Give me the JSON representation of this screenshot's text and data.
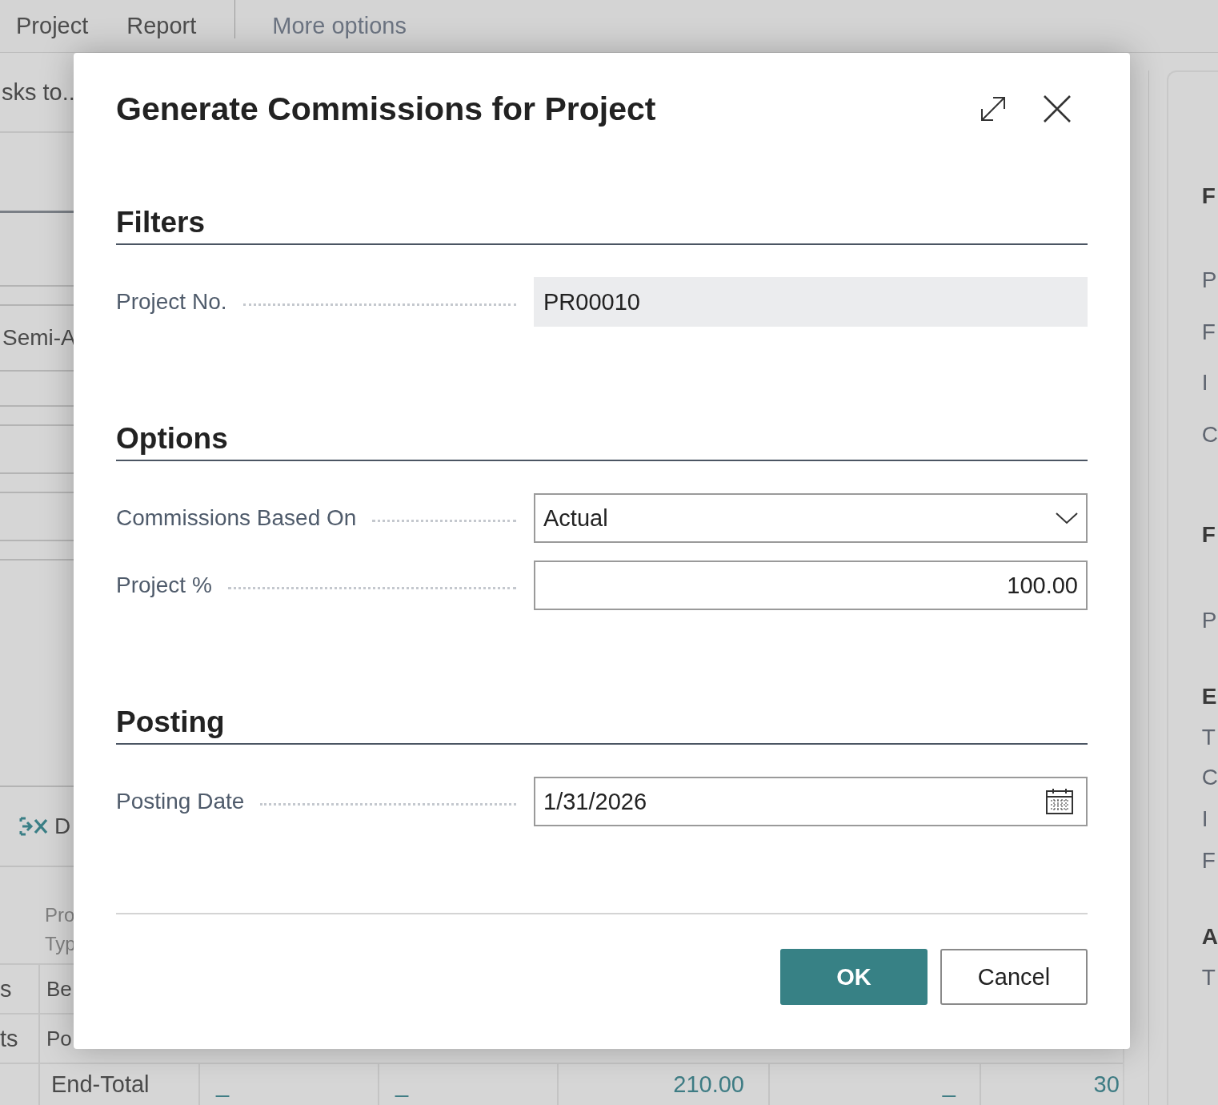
{
  "background": {
    "menu": [
      "Project",
      "Report"
    ],
    "more_options": "More options",
    "subtitle": "sks to..",
    "left_field": "Semi-A",
    "action": "D",
    "column_header": [
      "Pro",
      "Typ"
    ],
    "rows": [
      {
        "stub": "s",
        "name": "Be"
      },
      {
        "stub": "ts",
        "name": "Po"
      }
    ],
    "total_row": {
      "name": "End-Total",
      "values": [
        "_",
        "_",
        "210.00",
        "_",
        "30"
      ]
    },
    "factbox": [
      {
        "text": "F",
        "kind": "heading"
      },
      {
        "text": "P",
        "kind": "item"
      },
      {
        "text": "F",
        "kind": "item"
      },
      {
        "text": "I",
        "kind": "item"
      },
      {
        "text": "C",
        "kind": "item"
      },
      {
        "text": "F",
        "kind": "heading"
      },
      {
        "text": "P",
        "kind": "item"
      },
      {
        "text": "E",
        "kind": "heading"
      },
      {
        "text": "T",
        "kind": "item"
      },
      {
        "text": "C",
        "kind": "item"
      },
      {
        "text": "I",
        "kind": "item"
      },
      {
        "text": "F",
        "kind": "item"
      },
      {
        "text": "A",
        "kind": "heading"
      },
      {
        "text": "T",
        "kind": "item"
      }
    ]
  },
  "dialog": {
    "title": "Generate Commissions for Project",
    "sections": [
      {
        "heading": "Filters",
        "fields": [
          {
            "label": "Project No.",
            "kind": "readonly",
            "value": "PR00010"
          }
        ]
      },
      {
        "heading": "Options",
        "fields": [
          {
            "label": "Commissions Based On",
            "kind": "select",
            "value": "Actual"
          },
          {
            "label": "Project %",
            "kind": "number",
            "value": "100.00"
          }
        ]
      },
      {
        "heading": "Posting",
        "fields": [
          {
            "label": "Posting Date",
            "kind": "date",
            "value": "1/31/2026"
          }
        ]
      }
    ],
    "buttons": [
      {
        "label": "OK",
        "kind": "primary"
      },
      {
        "label": "Cancel",
        "kind": "secondary"
      }
    ]
  }
}
